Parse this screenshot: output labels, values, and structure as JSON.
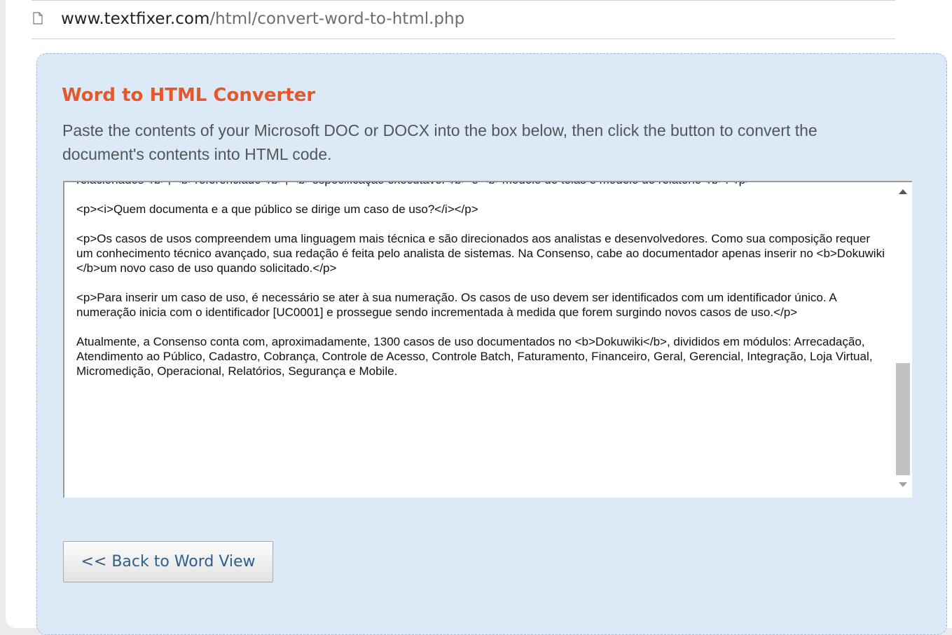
{
  "address_bar": {
    "url_host": "www.textfixer.com",
    "url_path": "/html/convert-word-to-html.php",
    "page_icon": "page-icon"
  },
  "converter": {
    "title": "Word to HTML Converter",
    "intro": "Paste the contents of your Microsoft DOC or DOCX into the box below, then click the button to convert the document's contents into HTML code.",
    "textarea_paragraphs": [
      "relacionados</b>, <b>referenciado</b>, <b>especificação executável</b> e <b>modelo de telas e modelo de relatório</b>.</p>",
      "<p><i>Quem documenta e a que público se dirige um caso de uso?</i></p>",
      "<p>Os casos de usos compreendem uma linguagem mais técnica e são direcionados aos analistas e desenvolvedores. Como sua composição requer um conhecimento técnico avançado, sua redação é feita pelo analista de sistemas. Na Consenso, cabe ao documentador apenas inserir no <b>Dokuwiki </b>um novo caso de uso quando solicitado.</p>",
      "<p>Para inserir um caso de uso, é necessário se ater à sua numeração. Os casos de uso devem ser identificados com um identificador único. A numeração inicia com o identificador [UC0001] e prossegue sendo incrementada à medida que forem surgindo novos casos de uso.</p>",
      "Atualmente, a Consenso conta com, aproximadamente, 1300 casos de uso documentados no <b>Dokuwiki</b>, divididos em módulos: Arrecadação, Atendimento ao Público, Cadastro, Cobrança, Controle de Acesso, Controle Batch, Faturamento, Financeiro, Geral, Gerencial, Integração, Loja Virtual, Micromedição, Operacional, Relatórios, Segurança e Mobile."
    ],
    "scroll_position": 0.62,
    "back_button_label": "<< Back to Word View"
  },
  "colors": {
    "title": "#e4592c",
    "panel_background": "#dce9f7",
    "button_text": "#2e5f8c"
  }
}
